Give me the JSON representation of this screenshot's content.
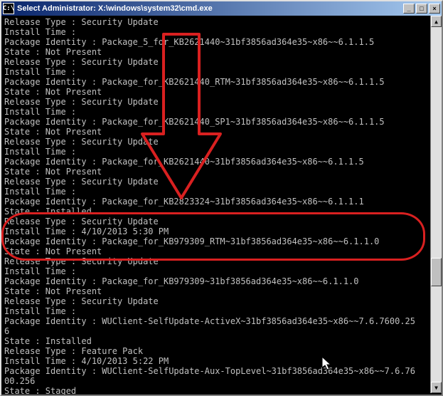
{
  "title": "Select Administrator: X:\\windows\\system32\\cmd.exe",
  "sys_icon_text": "C:\\",
  "btn_min": "_",
  "btn_max": "□",
  "btn_close": "×",
  "sb_up": "▲",
  "sb_down": "▼",
  "lines": [
    "Release Type : Security Update",
    "Install Time :",
    "",
    "Package Identity : Package_5_for_KB2621440~31bf3856ad364e35~x86~~6.1.1.5",
    "State : Not Present",
    "Release Type : Security Update",
    "Install Time :",
    "",
    "Package Identity : Package_for_KB2621440_RTM~31bf3856ad364e35~x86~~6.1.1.5",
    "State : Not Present",
    "Release Type : Security Update",
    "Install Time :",
    "",
    "Package Identity : Package_for_KB2621440_SP1~31bf3856ad364e35~x86~~6.1.1.5",
    "State : Not Present",
    "Release Type : Security Update",
    "Install Time :",
    "",
    "Package Identity : Package_for_KB2621440~31bf3856ad364e35~x86~~6.1.1.5",
    "State : Not Present",
    "Release Type : Security Update",
    "Install Time :",
    "",
    "Package Identity : Package_for_KB2823324~31bf3856ad364e35~x86~~6.1.1.1",
    "State : Installed",
    "Release Type : Security Update",
    "Install Time : 4/10/2013 5:30 PM",
    "",
    "Package Identity : Package_for_KB979309_RTM~31bf3856ad364e35~x86~~6.1.1.0",
    "State : Not Present",
    "Release Type : Security Update",
    "Install Time :",
    "",
    "Package Identity : Package_for_KB979309~31bf3856ad364e35~x86~~6.1.1.0",
    "State : Not Present",
    "Release Type : Security Update",
    "Install Time :",
    "",
    "Package Identity : WUClient-SelfUpdate-ActiveX~31bf3856ad364e35~x86~~7.6.7600.256",
    "State : Installed",
    "Release Type : Feature Pack",
    "Install Time : 4/10/2013 5:22 PM",
    "",
    "Package Identity : WUClient-SelfUpdate-Aux-TopLevel~31bf3856ad364e35~x86~~7.6.7600.256",
    "State : Staged"
  ],
  "annotation": {
    "arrow_color": "#d92020",
    "circle_color": "#d92020"
  }
}
